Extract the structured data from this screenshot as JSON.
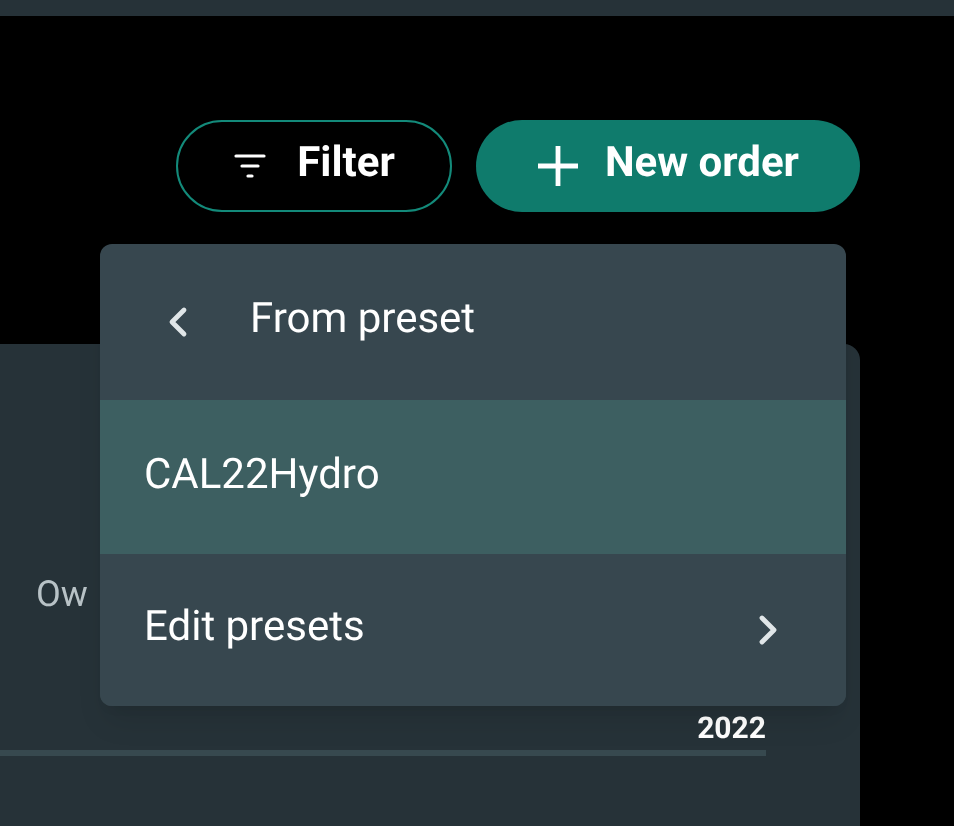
{
  "toolbar": {
    "filter_button": "Filter",
    "new_order_button": "New order"
  },
  "card": {
    "label": "Ow",
    "year": "2022"
  },
  "menu": {
    "title": "From preset",
    "items": [
      {
        "label": "CAL22Hydro",
        "kind": "option",
        "selected": true
      },
      {
        "label": "Edit presets",
        "kind": "submenu",
        "selected": false
      }
    ]
  }
}
